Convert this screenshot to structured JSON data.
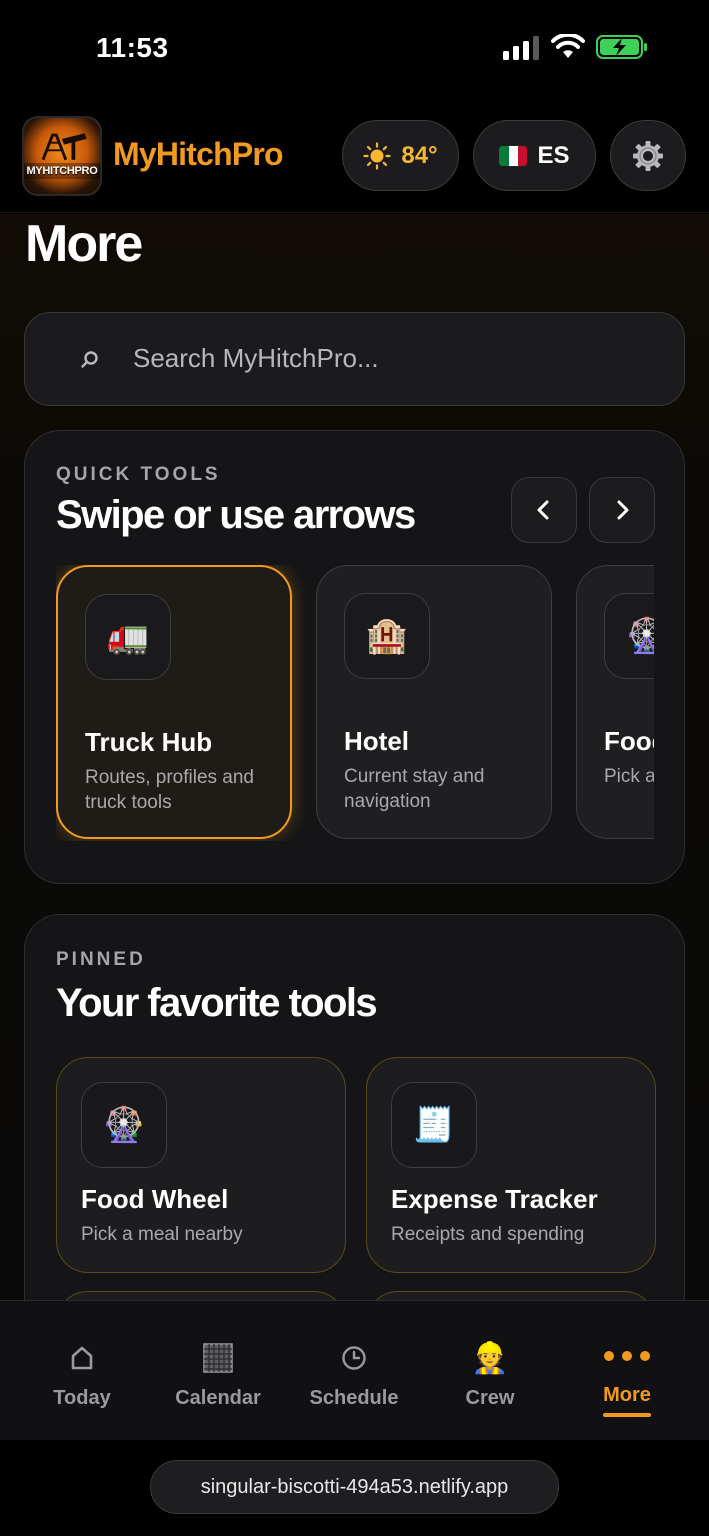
{
  "status_bar": {
    "time": "11:53"
  },
  "header": {
    "logo_text": "MYHITCHPRO",
    "brand": "MyHitchPro",
    "weather": {
      "temperature": "84°",
      "icon": "sun-icon"
    },
    "language": {
      "code": "ES",
      "flag": "mexico-flag-icon"
    },
    "settings_icon": "gear-icon"
  },
  "page": {
    "title": "More"
  },
  "search": {
    "placeholder": "Search MyHitchPro..."
  },
  "quick_tools": {
    "eyebrow": "QUICK TOOLS",
    "title": "Swipe or use arrows",
    "items": [
      {
        "name": "Truck Hub",
        "description": "Routes, profiles and truck tools",
        "icon": "🚛",
        "active": true
      },
      {
        "name": "Hotel",
        "description": "Current stay and navigation",
        "icon": "🏨",
        "active": false
      },
      {
        "name": "Food Wheel",
        "description": "Pick a meal nearby",
        "icon": "🎡",
        "active": false
      }
    ]
  },
  "pinned": {
    "eyebrow": "PINNED",
    "title": "Your favorite tools",
    "items": [
      {
        "name": "Food Wheel",
        "description": "Pick a meal nearby",
        "icon": "🎡"
      },
      {
        "name": "Expense Tracker",
        "description": "Receipts and spending",
        "icon": "🧾"
      }
    ]
  },
  "tabbar": {
    "items": [
      {
        "label": "Today",
        "icon": "home-icon"
      },
      {
        "label": "Calendar",
        "icon": "calendar-icon"
      },
      {
        "label": "Schedule",
        "icon": "clock-icon"
      },
      {
        "label": "Crew",
        "icon": "👷"
      },
      {
        "label": "More",
        "icon": "more-dots-icon",
        "active": true
      }
    ]
  },
  "browser": {
    "url": "singular-biscotti-494a53.netlify.app"
  },
  "colors": {
    "accent": "#f29a1f",
    "background": "#000000",
    "card": "#151517"
  }
}
